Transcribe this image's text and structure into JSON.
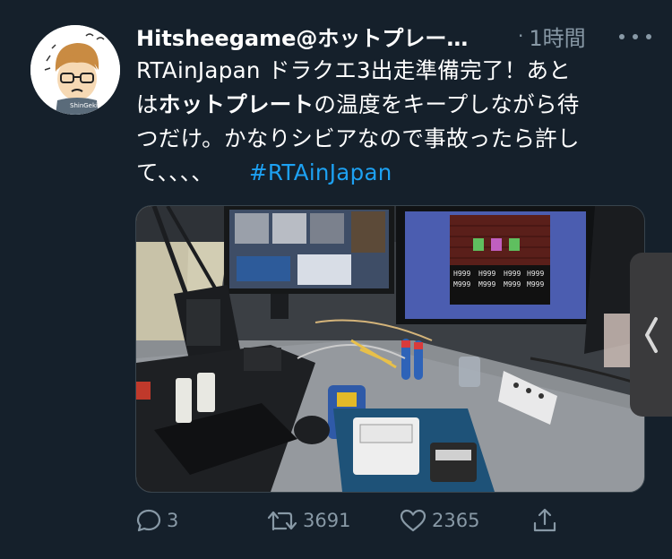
{
  "tweet": {
    "author_display": "Hitsheegame@ホットプレー…",
    "separator": "·",
    "time_ago": "1時間",
    "line1": "RTAinJapan ドラクエ3出走準備完了！あと",
    "line2_prefix": "は",
    "line2_bold": "ホットプレート",
    "line2_suffix": "の温度をキープしながら待",
    "line3": "つだけ。かなりシビアなので事故ったら許し",
    "line4": "て、、、、",
    "hashtag": "#RTAinJapan"
  },
  "media": {
    "screen_stats": [
      "H999",
      "M999",
      "H999",
      "M999",
      "H999",
      "M999",
      "H999",
      "M999"
    ]
  },
  "actions": {
    "replies": "3",
    "retweets": "3691",
    "likes": "2365"
  },
  "side_tab": {
    "icon": "chevron-left-icon"
  },
  "colors": {
    "background": "#15202b",
    "secondary_text": "#8899a6",
    "hashtag": "#1da1f2"
  }
}
